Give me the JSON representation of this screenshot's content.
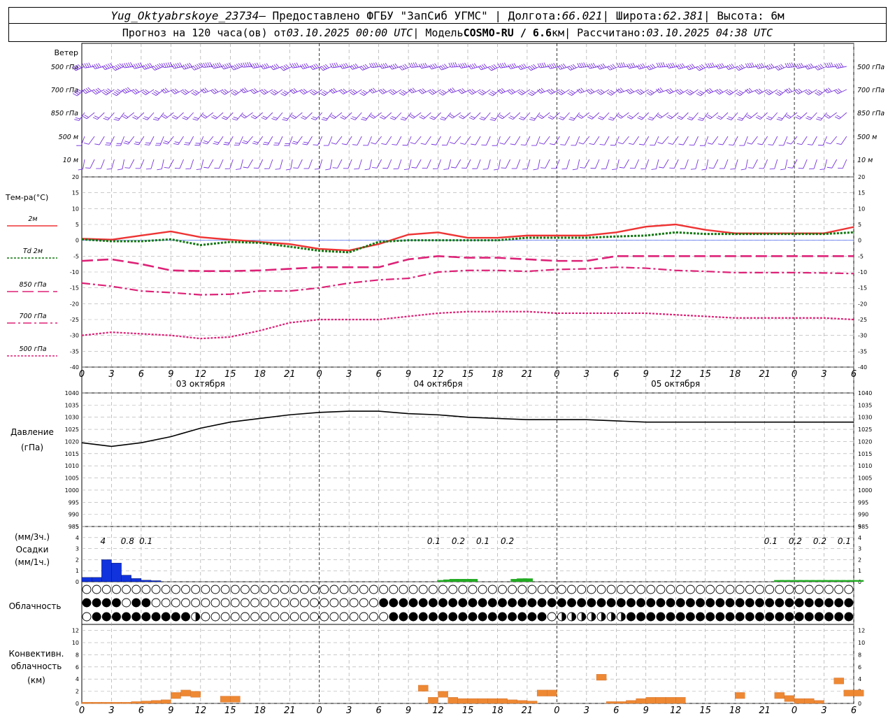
{
  "header": {
    "station": "Yug_Oktyabrskoye_23734",
    "provider": " – Предоставлено ФГБУ \"ЗапСиб УГМС\" | Долгота: ",
    "lon": "66.021",
    "lat_label": " | Широта: ",
    "lat": "62.381",
    "alt_label": " | Высота: 6м",
    "fc_label": "Прогноз на 120 часа(ов) от ",
    "fc_start": "03.10.2025 00:00 UTC",
    "model_label": " | Модель ",
    "model": "COSMO-RU / 6.6",
    "model_unit": "км",
    "calc_label": " | Рассчитано: ",
    "calc_time": "03.10.2025 04:38 UTC"
  },
  "panels": {
    "wind": {
      "title": "Ветер",
      "levels": [
        "500 гПа",
        "700 гПа",
        "850 гПа",
        "500 м",
        "10 м"
      ]
    },
    "temp": {
      "title": "Тем-ра(°C)",
      "legend": [
        "2м",
        "Td 2м",
        "850 гПа",
        "700 гПа",
        "500 гПа"
      ]
    },
    "pressure": {
      "title": "Давление",
      "unit": "(гПа)"
    },
    "precip": {
      "unit3": "(мм/3ч.)",
      "title": "Осадки",
      "unit1": "(мм/1ч.)",
      "labels": [
        [
          "4",
          3
        ],
        [
          "0.8",
          7
        ],
        [
          "0.1",
          10
        ],
        [
          "0.1",
          57
        ],
        [
          "0.2",
          61
        ],
        [
          "0.1",
          65
        ],
        [
          "0.2",
          69
        ],
        [
          "0.1",
          112
        ],
        [
          "0.2",
          116
        ],
        [
          "0.2",
          120
        ],
        [
          "0.1",
          124
        ]
      ]
    },
    "cloud": {
      "title": "Облачность"
    },
    "conv": {
      "title1": "Конвективн.",
      "title2": "облачность",
      "unit": "(км)"
    }
  },
  "colors": {
    "t2m": "#ee3333",
    "td": "#117711",
    "t850": "#dd2277",
    "t700": "#dd2277",
    "t500": "#dd2277",
    "wind": "#7733dd",
    "pressure": "#000000",
    "precip3": "#1133dd",
    "precip1": "#22aa22",
    "conv": "#ee8833"
  },
  "xaxis": {
    "ticks": [
      "0",
      "3",
      "6",
      "9",
      "12",
      "15",
      "18",
      "21",
      "0",
      "3",
      "6",
      "9",
      "12",
      "15",
      "18",
      "21",
      "0",
      "3",
      "6",
      "9",
      "12",
      "15",
      "18",
      "21",
      "0",
      "3",
      "6"
    ],
    "days": [
      "03 октября",
      "04 октября",
      "05 октября"
    ]
  },
  "chart_data": {
    "type": "meteogram",
    "x_hours": [
      0,
      3,
      6,
      9,
      12,
      15,
      18,
      21,
      24,
      27,
      30,
      33,
      36,
      39,
      42,
      45,
      48,
      51,
      54,
      57,
      60,
      63,
      66,
      69,
      72,
      75,
      78
    ],
    "temperature": {
      "ylim": [
        -40,
        20
      ],
      "yticks": [
        20,
        15,
        10,
        5,
        0,
        -5,
        -10,
        -15,
        -20,
        -25,
        -30,
        -35,
        -40
      ],
      "series": [
        {
          "name": "2м",
          "values": [
            0.5,
            0.2,
            1.5,
            2.8,
            1.0,
            0.2,
            -0.5,
            -1.2,
            -2.7,
            -3.2,
            -1.2,
            1.8,
            2.5,
            0.8,
            0.8,
            1.5,
            1.5,
            1.5,
            2.5,
            4.3,
            5.0,
            3.3,
            2.2,
            2.2,
            2.2,
            2.2,
            4.2
          ]
        },
        {
          "name": "Td 2м",
          "values": [
            0.3,
            -0.3,
            -0.3,
            0.3,
            -1.5,
            -0.5,
            -0.8,
            -2.0,
            -3.3,
            -3.8,
            -0.5,
            0.0,
            0.0,
            0.0,
            0.0,
            0.8,
            0.8,
            0.8,
            1.2,
            1.5,
            2.5,
            2.0,
            2.0,
            2.0,
            2.0,
            2.0,
            2.5
          ]
        },
        {
          "name": "850 гПа",
          "values": [
            -6.5,
            -6.0,
            -7.5,
            -9.5,
            -9.7,
            -9.7,
            -9.5,
            -9.0,
            -8.5,
            -8.5,
            -8.5,
            -6.0,
            -5.0,
            -5.5,
            -5.5,
            -6.0,
            -6.5,
            -6.5,
            -5.0,
            -5.0,
            -5.0,
            -5.0,
            -5.0,
            -5.0,
            -5.0,
            -5.0,
            -5.0
          ]
        },
        {
          "name": "700 гПа",
          "values": [
            -13.5,
            -14.5,
            -16.0,
            -16.5,
            -17.2,
            -17.0,
            -16.0,
            -16.0,
            -15.0,
            -13.5,
            -12.5,
            -12.0,
            -10.0,
            -9.5,
            -9.5,
            -9.8,
            -9.2,
            -9.0,
            -8.5,
            -8.8,
            -9.5,
            -9.8,
            -10.2,
            -10.2,
            -10.2,
            -10.3,
            -10.5
          ]
        },
        {
          "name": "500 гПа",
          "values": [
            -30.0,
            -29.0,
            -29.5,
            -30.0,
            -31.0,
            -30.5,
            -28.5,
            -26.0,
            -25.0,
            -25.0,
            -25.0,
            -24.0,
            -23.0,
            -22.5,
            -22.5,
            -22.5,
            -23.0,
            -23.0,
            -23.0,
            -23.0,
            -23.5,
            -24.0,
            -24.5,
            -24.5,
            -24.5,
            -24.5,
            -25.0
          ]
        }
      ]
    },
    "pressure": {
      "ylim": [
        985,
        1040
      ],
      "yticks": [
        1040,
        1035,
        1030,
        1025,
        1020,
        1015,
        1010,
        1005,
        1000,
        995,
        990,
        985
      ],
      "values": [
        1019.5,
        1018.0,
        1019.5,
        1022.0,
        1025.5,
        1028.0,
        1029.5,
        1031.0,
        1032.0,
        1032.5,
        1032.5,
        1031.5,
        1031.0,
        1030.0,
        1029.5,
        1029.0,
        1029.0,
        1029.0,
        1028.5,
        1028.0,
        1028.0,
        1028.0,
        1028.0,
        1028.0,
        1028.0,
        1028.0,
        1028.0
      ]
    },
    "precip": {
      "ylim": [
        0,
        5
      ],
      "yticks": [
        5,
        4,
        3,
        2,
        1,
        0
      ],
      "hourly_blue": [
        [
          0,
          0.4
        ],
        [
          1,
          0.4
        ],
        [
          2,
          2.0
        ],
        [
          3,
          1.7
        ],
        [
          4,
          0.6
        ],
        [
          5,
          0.3
        ],
        [
          6,
          0.15
        ],
        [
          7,
          0.1
        ]
      ],
      "hourly_green": [
        [
          58,
          0.15
        ],
        [
          59,
          0.2
        ],
        [
          60,
          0.25
        ],
        [
          61,
          0.25
        ],
        [
          62,
          0.25
        ],
        [
          63,
          0.25
        ],
        [
          70,
          0.25
        ],
        [
          71,
          0.3
        ],
        [
          72,
          0.3
        ],
        [
          113,
          0.15
        ],
        [
          114,
          0.15
        ],
        [
          115,
          0.15
        ],
        [
          116,
          0.15
        ],
        [
          117,
          0.15
        ],
        [
          118,
          0.15
        ],
        [
          119,
          0.15
        ],
        [
          120,
          0.15
        ],
        [
          121,
          0.15
        ],
        [
          122,
          0.15
        ],
        [
          123,
          0.15
        ],
        [
          124,
          0.15
        ],
        [
          125,
          0.15
        ],
        [
          126,
          0.15
        ]
      ]
    },
    "cloud_rows": {
      "high": "000000000000000000000000000000ooooooooooooooo4o0000000000000000000000000000000000000000000000000000000000000000000000000",
      "mid": "444444034440000000000000000000000000000000000000444444444444444444444444444444444444444444444444444444444444444444444444444444",
      "low": "044444444404444403000000000000000000000000000000444444444444444444444444420222222222224444444444444444444444444444444444444"
    },
    "convective": {
      "ylim": [
        0,
        13
      ],
      "yticks": [
        12,
        10,
        8,
        6,
        4,
        2,
        0
      ],
      "bars": [
        [
          0,
          0.2
        ],
        [
          1,
          0.2
        ],
        [
          2,
          0.2
        ],
        [
          3,
          0.2
        ],
        [
          4,
          0.2
        ],
        [
          5,
          0.3
        ],
        [
          6,
          0.4
        ],
        [
          7,
          0.5
        ],
        [
          8,
          0.6
        ],
        [
          9,
          1.8
        ],
        [
          10,
          2.2
        ],
        [
          11,
          2.0
        ],
        [
          14,
          1.2
        ],
        [
          15,
          1.2
        ],
        [
          34,
          3.0
        ],
        [
          35,
          1.0
        ],
        [
          36,
          2.0
        ],
        [
          37,
          1.0
        ],
        [
          38,
          0.8
        ],
        [
          39,
          0.8
        ],
        [
          40,
          0.8
        ],
        [
          41,
          0.8
        ],
        [
          42,
          0.8
        ],
        [
          43,
          0.6
        ],
        [
          44,
          0.5
        ],
        [
          45,
          0.4
        ],
        [
          46,
          2.2
        ],
        [
          47,
          2.2
        ],
        [
          52,
          4.8
        ],
        [
          53,
          0.3
        ],
        [
          54,
          0.3
        ],
        [
          55,
          0.5
        ],
        [
          56,
          0.8
        ],
        [
          57,
          1.0
        ],
        [
          58,
          1.0
        ],
        [
          59,
          1.0
        ],
        [
          60,
          1.0
        ],
        [
          66,
          1.8
        ],
        [
          70,
          1.8
        ],
        [
          71,
          1.3
        ],
        [
          72,
          0.8
        ],
        [
          73,
          0.8
        ],
        [
          74,
          0.5
        ],
        [
          76,
          4.2
        ],
        [
          77,
          2.2
        ],
        [
          78,
          2.2
        ]
      ]
    },
    "wind": {
      "rows": [
        {
          "name": "500 гПа",
          "dir": 255,
          "speed": [
            40,
            45,
            45,
            45,
            45,
            45,
            40,
            40,
            40,
            40,
            40,
            40,
            40,
            40,
            40,
            40,
            40,
            40,
            40,
            40,
            40,
            40,
            40,
            40,
            40,
            40,
            40
          ]
        },
        {
          "name": "700 гПа",
          "dir": 240,
          "speed": [
            35,
            35,
            30,
            30,
            30,
            30,
            30,
            30,
            30,
            30,
            30,
            25,
            25,
            25,
            25,
            25,
            25,
            25,
            25,
            25,
            25,
            25,
            25,
            25,
            25,
            25,
            25
          ]
        },
        {
          "name": "850 гПа",
          "dir": 225,
          "speed": [
            15,
            20,
            20,
            20,
            20,
            20,
            20,
            20,
            15,
            15,
            15,
            15,
            15,
            15,
            15,
            15,
            15,
            15,
            15,
            15,
            15,
            15,
            15,
            15,
            15,
            15,
            15
          ]
        },
        {
          "name": "500 м",
          "dir": 210,
          "speed": [
            10,
            15,
            15,
            15,
            15,
            15,
            15,
            15,
            10,
            10,
            10,
            10,
            10,
            10,
            10,
            10,
            10,
            10,
            10,
            10,
            10,
            10,
            10,
            10,
            10,
            10,
            10
          ]
        },
        {
          "name": "10 м",
          "dir": 200,
          "speed": [
            5,
            10,
            5,
            5,
            5,
            5,
            5,
            5,
            5,
            5,
            5,
            5,
            5,
            5,
            5,
            5,
            5,
            10,
            10,
            5,
            5,
            5,
            5,
            5,
            5,
            5,
            5
          ]
        }
      ]
    }
  }
}
